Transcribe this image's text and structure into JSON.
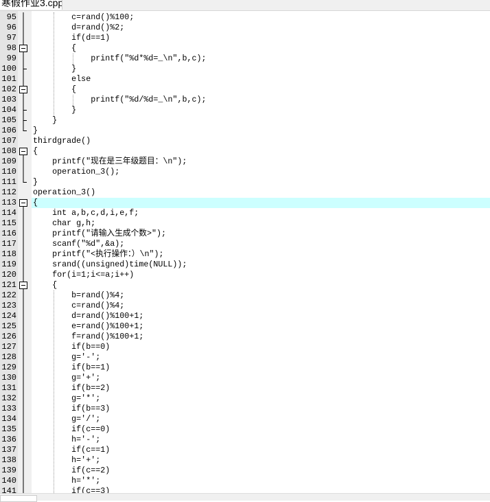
{
  "tab": {
    "title": "寒假作业3.cpp"
  },
  "colors": {
    "keyword": "#000000",
    "operator": "#ff0000",
    "number": "#8000ff",
    "string": "#0000ff",
    "current_line": "#ccffff"
  },
  "current_line": 113,
  "lines": [
    {
      "n": "95",
      "indent": 8,
      "code": "c=rand()%100;",
      "fold": "line"
    },
    {
      "n": "96",
      "indent": 8,
      "code": "d=rand()%2;",
      "fold": "line"
    },
    {
      "n": "97",
      "indent": 8,
      "code": "if(d==1)",
      "fold": "line"
    },
    {
      "n": "98",
      "indent": 8,
      "code": "{",
      "fold": "box"
    },
    {
      "n": "99",
      "indent": 12,
      "code": "printf(\"%d*%d=_\\n\",b,c);",
      "fold": "line"
    },
    {
      "n": "100",
      "indent": 8,
      "code": "}",
      "fold": "tick"
    },
    {
      "n": "101",
      "indent": 8,
      "code": "else",
      "fold": "line"
    },
    {
      "n": "102",
      "indent": 8,
      "code": "{",
      "fold": "box"
    },
    {
      "n": "103",
      "indent": 12,
      "code": "printf(\"%d/%d=_\\n\",b,c);",
      "fold": "line"
    },
    {
      "n": "104",
      "indent": 8,
      "code": "}",
      "fold": "tick"
    },
    {
      "n": "105",
      "indent": 4,
      "code": "}",
      "fold": "tick"
    },
    {
      "n": "106",
      "indent": 0,
      "code": "}",
      "fold": "end"
    },
    {
      "n": "107",
      "indent": 0,
      "code": "thirdgrade()",
      "fold": "none"
    },
    {
      "n": "108",
      "indent": 0,
      "code": "{",
      "fold": "boxstart"
    },
    {
      "n": "109",
      "indent": 4,
      "code": "printf(\"现在是三年级题目：\\n\");",
      "fold": "line"
    },
    {
      "n": "110",
      "indent": 4,
      "code": "operation_3();",
      "fold": "line"
    },
    {
      "n": "111",
      "indent": 0,
      "code": "}",
      "fold": "end"
    },
    {
      "n": "112",
      "indent": 0,
      "code": "operation_3()",
      "fold": "none"
    },
    {
      "n": "113",
      "indent": 0,
      "code": "{",
      "fold": "boxstart"
    },
    {
      "n": "114",
      "indent": 4,
      "code": "int a,b,c,d,i,e,f;",
      "fold": "line"
    },
    {
      "n": "115",
      "indent": 4,
      "code": "char g,h;",
      "fold": "line"
    },
    {
      "n": "116",
      "indent": 4,
      "code": "printf(\"请输入生成个数>\");",
      "fold": "line"
    },
    {
      "n": "117",
      "indent": 4,
      "code": "scanf(\"%d\",&a);",
      "fold": "line"
    },
    {
      "n": "118",
      "indent": 4,
      "code": "printf(\"<执行操作：）\\n\");",
      "fold": "line"
    },
    {
      "n": "119",
      "indent": 4,
      "code": "srand((unsigned)time(NULL));",
      "fold": "line"
    },
    {
      "n": "120",
      "indent": 4,
      "code": "for(i=1;i<=a;i++)",
      "fold": "line"
    },
    {
      "n": "121",
      "indent": 4,
      "code": "{",
      "fold": "box"
    },
    {
      "n": "122",
      "indent": 8,
      "code": "b=rand()%4;",
      "fold": "line"
    },
    {
      "n": "123",
      "indent": 8,
      "code": "c=rand()%4;",
      "fold": "line"
    },
    {
      "n": "124",
      "indent": 8,
      "code": "d=rand()%100+1;",
      "fold": "line"
    },
    {
      "n": "125",
      "indent": 8,
      "code": "e=rand()%100+1;",
      "fold": "line"
    },
    {
      "n": "126",
      "indent": 8,
      "code": "f=rand()%100+1;",
      "fold": "line"
    },
    {
      "n": "127",
      "indent": 8,
      "code": "if(b==0)",
      "fold": "line"
    },
    {
      "n": "128",
      "indent": 8,
      "code": "g='-';",
      "fold": "line"
    },
    {
      "n": "129",
      "indent": 8,
      "code": "if(b==1)",
      "fold": "line"
    },
    {
      "n": "130",
      "indent": 8,
      "code": "g='+';",
      "fold": "line"
    },
    {
      "n": "131",
      "indent": 8,
      "code": "if(b==2)",
      "fold": "line"
    },
    {
      "n": "132",
      "indent": 8,
      "code": "g='*';",
      "fold": "line"
    },
    {
      "n": "133",
      "indent": 8,
      "code": "if(b==3)",
      "fold": "line"
    },
    {
      "n": "134",
      "indent": 8,
      "code": "g='/';",
      "fold": "line"
    },
    {
      "n": "135",
      "indent": 8,
      "code": "if(c==0)",
      "fold": "line"
    },
    {
      "n": "136",
      "indent": 8,
      "code": "h='-';",
      "fold": "line"
    },
    {
      "n": "137",
      "indent": 8,
      "code": "if(c==1)",
      "fold": "line"
    },
    {
      "n": "138",
      "indent": 8,
      "code": "h='+';",
      "fold": "line"
    },
    {
      "n": "139",
      "indent": 8,
      "code": "if(c==2)",
      "fold": "line"
    },
    {
      "n": "140",
      "indent": 8,
      "code": "h='*';",
      "fold": "line"
    },
    {
      "n": "141",
      "indent": 8,
      "code": "if(c==3)",
      "fold": "line"
    }
  ]
}
